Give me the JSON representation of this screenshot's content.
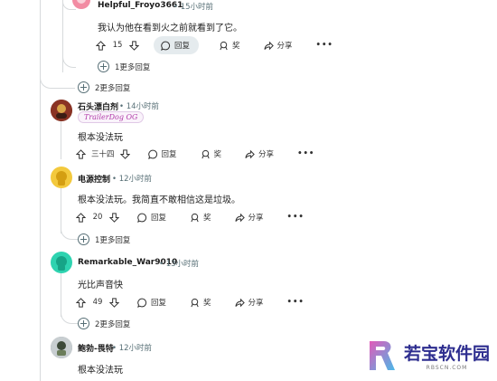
{
  "comments": [
    {
      "username": "Helpful_Froyo3661",
      "time": "• 15小时前",
      "body": "我认为他在看到火之前就看到了它。",
      "votes": "15",
      "reply_label": "回复",
      "award_label": "奖",
      "share_label": "分享",
      "more_label": "•••",
      "more_replies": "1更多回复"
    },
    {
      "more_replies": "2更多回复"
    },
    {
      "username": "石头漂白剂",
      "time": "• 14小时前",
      "flair": "TrailerDog OG",
      "body": "根本没法玩",
      "votes": "三十四",
      "reply_label": "回复",
      "award_label": "奖",
      "share_label": "分享",
      "more_label": "•••"
    },
    {
      "username": "电源控制",
      "time": "• 12小时前",
      "body": "根本没法玩。我简直不敢相信这是垃圾。",
      "votes": "20",
      "reply_label": "回复",
      "award_label": "奖",
      "share_label": "分享",
      "more_label": "•••",
      "more_replies": "1更多回复"
    },
    {
      "username": "Remarkable_War9010",
      "time": "• 13小时前",
      "body": "光比声音快",
      "votes": "49",
      "reply_label": "回复",
      "award_label": "奖",
      "share_label": "分享",
      "more_label": "•••",
      "more_replies": "2更多回复"
    },
    {
      "username": "鲍勃-畏特",
      "time": "• 12小时前",
      "body": "根本没法玩"
    }
  ],
  "watermark": {
    "title": "若宝软件园",
    "subtitle": "RBSCN.COM"
  },
  "colors": {
    "thread_line": "#d7dadc",
    "active_button_bg": "#e5ebee",
    "meta_text": "#576f76",
    "avatar_pink": "#f28ca3",
    "avatar_yellow": "#f3c93d",
    "avatar_teal": "#2ed3b0",
    "avatar_gray": "#9aa3a8"
  }
}
